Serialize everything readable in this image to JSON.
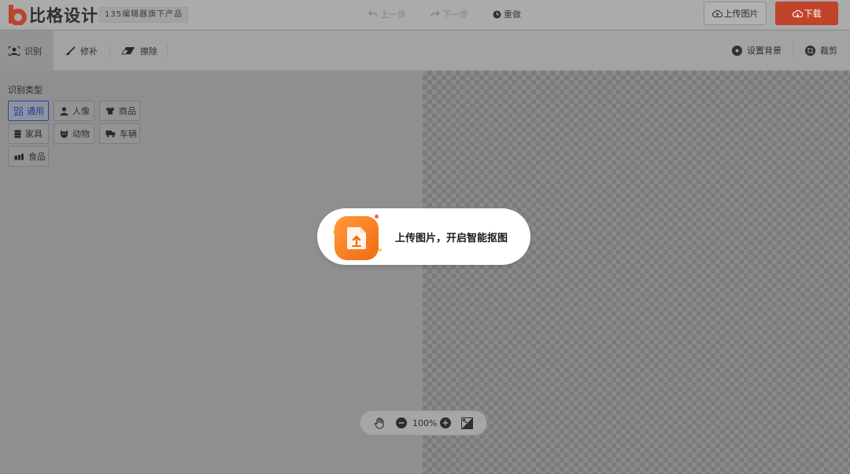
{
  "header": {
    "logo_text": "比格设计",
    "tagline": "135编辑器旗下产品",
    "undo_label": "上一步",
    "redo_label": "下一步",
    "reset_label": "重做",
    "upload_label": "上传图片",
    "download_label": "下载"
  },
  "toolbar": {
    "tools": [
      {
        "label": "识别",
        "icon": "detect-icon",
        "active": true
      },
      {
        "label": "修补",
        "icon": "brush-icon"
      },
      {
        "label": "擦除",
        "icon": "eraser-icon"
      }
    ],
    "set_background_label": "设置背景",
    "crop_label": "裁剪"
  },
  "panel": {
    "title": "识别类型",
    "types": [
      {
        "label": "通用",
        "icon": "general-icon",
        "selected": true
      },
      {
        "label": "人像",
        "icon": "person-icon"
      },
      {
        "label": "商品",
        "icon": "clothes-icon"
      },
      {
        "label": "家具",
        "icon": "furniture-icon"
      },
      {
        "label": "动物",
        "icon": "animal-icon"
      },
      {
        "label": "车辆",
        "icon": "truck-icon"
      },
      {
        "label": "食品",
        "icon": "food-icon"
      }
    ]
  },
  "prompt": {
    "text": "上传图片，开启智能抠图"
  },
  "zoom": {
    "level": "100%"
  },
  "colors": {
    "brand": "#e4502f",
    "selected_chip": "#25479a",
    "upload_icon": "#f26a12"
  }
}
